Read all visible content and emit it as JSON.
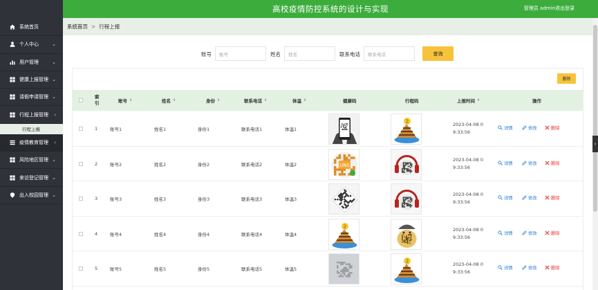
{
  "header": {
    "title": "高校疫情防控系统的设计与实现",
    "user": "管理员 admin",
    "logout": "退出登录"
  },
  "sidebar": {
    "items": [
      {
        "label": "系统首页",
        "icon": "home-icon",
        "chevron": ""
      },
      {
        "label": "个人中心",
        "icon": "user-icon",
        "chevron": "⌄"
      },
      {
        "label": "用户管理",
        "icon": "bar-chart-icon",
        "chevron": "⌄"
      },
      {
        "label": "健康上报管理",
        "icon": "grid-icon",
        "chevron": "⌄"
      },
      {
        "label": "请假申请管理",
        "icon": "grid-icon",
        "chevron": "⌄"
      },
      {
        "label": "行程上报管理",
        "icon": "grid-icon",
        "chevron": "‹"
      },
      {
        "label": "疫情教育管理",
        "icon": "list-icon",
        "chevron": "‹"
      },
      {
        "label": "风险地区管理",
        "icon": "grid-icon",
        "chevron": "⌄"
      },
      {
        "label": "来访登记管理",
        "icon": "grid-icon",
        "chevron": "⌄"
      },
      {
        "label": "出入校园管理",
        "icon": "location-icon",
        "chevron": "⌄"
      }
    ],
    "sub_item": "行程上报"
  },
  "breadcrumb": {
    "home": "系统首页",
    "sep": ">",
    "current": "行程上报"
  },
  "search": {
    "account_label": "账号",
    "account_placeholder": "账号",
    "name_label": "姓名",
    "name_placeholder": "姓名",
    "phone_label": "联系电话",
    "phone_placeholder": "联系电话",
    "button": "查询"
  },
  "table": {
    "delete_button": "删除",
    "headers": {
      "index": "索引",
      "account": "账号",
      "name": "姓名",
      "idcard": "身份",
      "phone": "联系电话",
      "temp": "体温",
      "health_code": "健康码",
      "trip_code": "行程码",
      "time": "上报时间",
      "ops": "操作"
    },
    "actions": {
      "detail": "详情",
      "edit": "修改",
      "delete": "删除"
    },
    "rows": [
      {
        "index": "1",
        "account": "账号1",
        "name": "姓名1",
        "idcard": "身份1",
        "phone": "联系电话1",
        "temp": "体温1",
        "date": "2023-04-08 0",
        "clock": "9:33:56",
        "health_img": "phone-qr",
        "trip_img": "cake"
      },
      {
        "index": "2",
        "account": "账号2",
        "name": "姓名2",
        "idcard": "身份2",
        "phone": "联系电话2",
        "temp": "体温2",
        "date": "2023-04-08 0",
        "clock": "9:33:56",
        "health_img": "orange-qr",
        "trip_img": "headphone-qr"
      },
      {
        "index": "3",
        "account": "账号3",
        "name": "姓名3",
        "idcard": "身份3",
        "phone": "联系电话3",
        "temp": "体温3",
        "date": "2023-04-08 0",
        "clock": "9:33:56",
        "health_img": "diamond-qr",
        "trip_img": "headphone-qr"
      },
      {
        "index": "4",
        "account": "账号4",
        "name": "姓名4",
        "idcard": "身份4",
        "phone": "联系电话4",
        "temp": "体温4",
        "date": "2023-04-08 0",
        "clock": "9:33:56",
        "health_img": "cake",
        "trip_img": "lamp-qr"
      },
      {
        "index": "5",
        "account": "账号5",
        "name": "姓名5",
        "idcard": "身份5",
        "phone": "联系电话5",
        "temp": "体温5",
        "date": "2023-04-08 0",
        "clock": "9:33:56",
        "health_img": "gray-qr",
        "trip_img": "cake"
      }
    ]
  },
  "colors": {
    "header_green": "#3cad3c",
    "sidebar_dark": "#2f3339",
    "accent_yellow": "#f7c33b",
    "table_head": "#e2f1e2",
    "link_blue": "#2c7fd4",
    "danger_red": "#e33333"
  }
}
